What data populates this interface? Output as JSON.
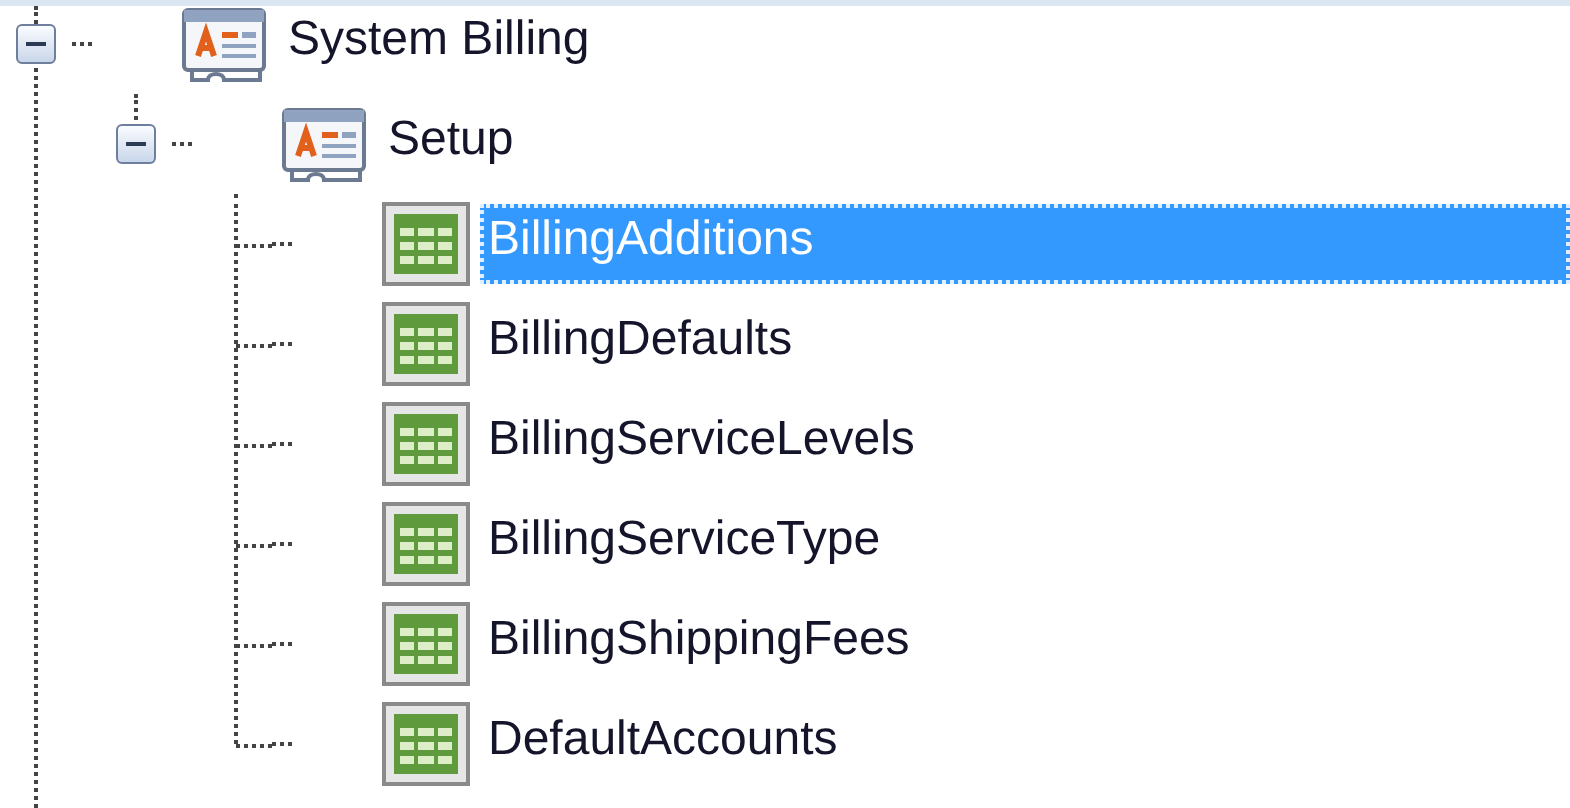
{
  "tree": [
    {
      "label": "System Billing",
      "kind": "form",
      "expanded": true,
      "selected": false,
      "children": [
        {
          "label": "Setup",
          "kind": "form",
          "expanded": true,
          "selected": false,
          "children": [
            {
              "label": "BillingAdditions",
              "kind": "table",
              "selected": true
            },
            {
              "label": "BillingDefaults",
              "kind": "table",
              "selected": false
            },
            {
              "label": "BillingServiceLevels",
              "kind": "table",
              "selected": false
            },
            {
              "label": "BillingServiceType",
              "kind": "table",
              "selected": false
            },
            {
              "label": "BillingShippingFees",
              "kind": "table",
              "selected": false
            },
            {
              "label": "DefaultAccounts",
              "kind": "table",
              "selected": false
            }
          ]
        }
      ]
    }
  ]
}
